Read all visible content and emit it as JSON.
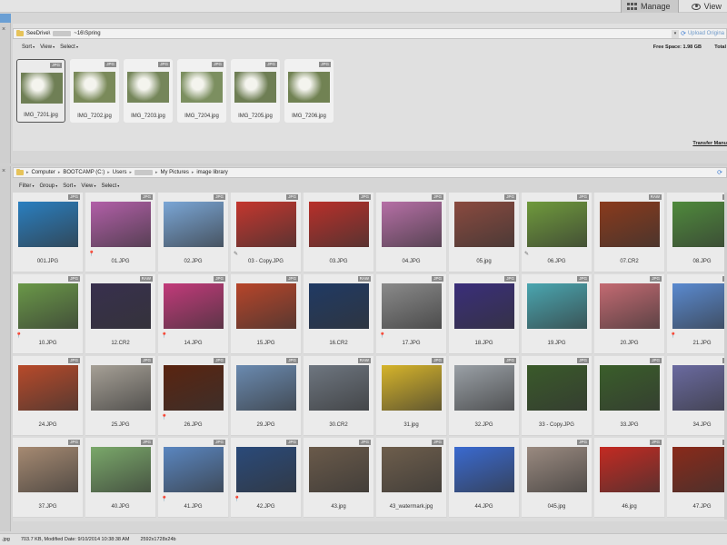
{
  "toolbar": {
    "manage_label": "Manage",
    "view_label": "View"
  },
  "upper": {
    "path_left": "SeeDrive\\",
    "path_right": "~16\\Spring",
    "upload_label": "Upload Origina",
    "menus": [
      "Sort",
      "View",
      "Select"
    ],
    "free_space": "Free Space: 1.98 GB",
    "total": "Total",
    "transfer": "Transfer Manu",
    "photos": [
      {
        "name": "IMG_7201.jpg",
        "badge": "JPG",
        "color": "#6f7f55"
      },
      {
        "name": "IMG_7202.jpg",
        "badge": "JPG",
        "color": "#7a8a5a"
      },
      {
        "name": "IMG_7203.jpg",
        "badge": "JPG",
        "color": "#75865a"
      },
      {
        "name": "IMG_7204.jpg",
        "badge": "JPG",
        "color": "#7c8f60"
      },
      {
        "name": "IMG_7205.jpg",
        "badge": "JPG",
        "color": "#6e7e54"
      },
      {
        "name": "IMG_7206.jpg",
        "badge": "JPG",
        "color": "#718253"
      }
    ]
  },
  "lower": {
    "crumbs": [
      "Computer",
      "BOOTCAMP (C:)",
      "Users",
      "",
      "My Pictures",
      "image library"
    ],
    "menus": [
      "Filter",
      "Group",
      "Sort",
      "View",
      "Select"
    ],
    "photos": [
      {
        "name": "001.JPG",
        "badge": "JPG",
        "color": "#2a7fc0",
        "mk": ""
      },
      {
        "name": "01.JPG",
        "badge": "JPG",
        "color": "#b25fa8",
        "mk": "⬤"
      },
      {
        "name": "02.JPG",
        "badge": "JPG",
        "color": "#7aa6d6",
        "mk": ""
      },
      {
        "name": "03 - Copy.JPG",
        "badge": "JPG",
        "color": "#c4362e",
        "mk": "✎"
      },
      {
        "name": "03.JPG",
        "badge": "JPG",
        "color": "#b8302a",
        "mk": ""
      },
      {
        "name": "04.JPG",
        "badge": "JPG",
        "color": "#b66fa6",
        "mk": ""
      },
      {
        "name": "05.jpg",
        "badge": "JPG",
        "color": "#8a4a3f",
        "mk": ""
      },
      {
        "name": "06.JPG",
        "badge": "JPG",
        "color": "#6f9a3c",
        "mk": "✎"
      },
      {
        "name": "07.CR2",
        "badge": "RAW",
        "color": "#8a3a1c",
        "mk": ""
      },
      {
        "name": "08.JPG",
        "badge": "JPG",
        "color": "#4f8a3c",
        "mk": ""
      },
      {
        "name": "10.JPG",
        "badge": "JPG",
        "color": "#6a9848",
        "mk": "⬤"
      },
      {
        "name": "12.CR2",
        "badge": "RAW",
        "color": "#38304e",
        "mk": ""
      },
      {
        "name": "14.JPG",
        "badge": "JPG",
        "color": "#c23a7a",
        "mk": "⬤"
      },
      {
        "name": "15.JPG",
        "badge": "JPG",
        "color": "#b7452a",
        "mk": ""
      },
      {
        "name": "16.CR2",
        "badge": "RAW",
        "color": "#203a64",
        "mk": ""
      },
      {
        "name": "17.JPG",
        "badge": "JPG",
        "color": "#8a8a8a",
        "mk": "⬤"
      },
      {
        "name": "18.JPG",
        "badge": "JPG",
        "color": "#3a2e7a",
        "mk": ""
      },
      {
        "name": "19.JPG",
        "badge": "JPG",
        "color": "#4aa6b0",
        "mk": ""
      },
      {
        "name": "20.JPG",
        "badge": "JPG",
        "color": "#c46a72",
        "mk": ""
      },
      {
        "name": "21.JPG",
        "badge": "JPG",
        "color": "#5a8ad0",
        "mk": "⬤"
      },
      {
        "name": "24.JPG",
        "badge": "JPG",
        "color": "#b84a2a",
        "mk": ""
      },
      {
        "name": "25.JPG",
        "badge": "JPG",
        "color": "#a6a096",
        "mk": ""
      },
      {
        "name": "26.JPG",
        "badge": "JPG",
        "color": "#5a2410",
        "mk": "⬤"
      },
      {
        "name": "29.JPG",
        "badge": "JPG",
        "color": "#6a8ab0",
        "mk": ""
      },
      {
        "name": "30.CR2",
        "badge": "RAW",
        "color": "#6e7680",
        "mk": ""
      },
      {
        "name": "31.jpg",
        "badge": "JPG",
        "color": "#d6b42a",
        "mk": ""
      },
      {
        "name": "32.JPG",
        "badge": "JPG",
        "color": "#9aa0a6",
        "mk": ""
      },
      {
        "name": "33 - Copy.JPG",
        "badge": "JPG",
        "color": "#3a5a2a",
        "mk": ""
      },
      {
        "name": "33.JPG",
        "badge": "JPG",
        "color": "#3a5e2a",
        "mk": ""
      },
      {
        "name": "34.JPG",
        "badge": "JPG",
        "color": "#6a6aa0",
        "mk": ""
      },
      {
        "name": "37.JPG",
        "badge": "JPG",
        "color": "#a68a72",
        "mk": ""
      },
      {
        "name": "40.JPG",
        "badge": "JPG",
        "color": "#7aa86a",
        "mk": ""
      },
      {
        "name": "41.JPG",
        "badge": "JPG",
        "color": "#5a86c0",
        "mk": "⬤"
      },
      {
        "name": "42.JPG",
        "badge": "JPG",
        "color": "#2a4a7a",
        "mk": "⬤"
      },
      {
        "name": "43.jpg",
        "badge": "JPG",
        "color": "#6a5a4a",
        "mk": ""
      },
      {
        "name": "43_watermark.jpg",
        "badge": "JPG",
        "color": "#6e5e4c",
        "mk": ""
      },
      {
        "name": "44.JPG",
        "badge": "",
        "color": "#3a6ad0",
        "mk": ""
      },
      {
        "name": "045.jpg",
        "badge": "JPG",
        "color": "#9a8a80",
        "mk": ""
      },
      {
        "name": "46.jpg",
        "badge": "JPG",
        "color": "#c42a22",
        "mk": ""
      },
      {
        "name": "47.JPG",
        "badge": "JPG",
        "color": "#8a2a1a",
        "mk": ""
      }
    ]
  },
  "status": {
    "file": ".jpg",
    "info": "703.7 KB, Modified Date: 9/10/2014 10:38:38 AM",
    "dims": "2592x1728x24b"
  }
}
